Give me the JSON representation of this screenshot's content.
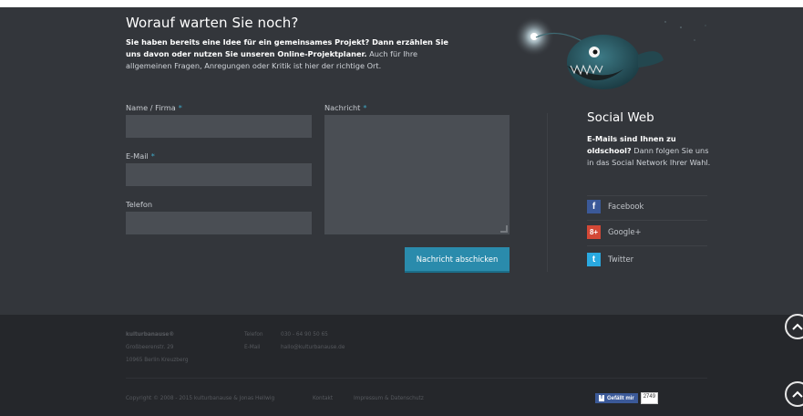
{
  "intro": {
    "title": "Worauf warten Sie noch?",
    "text_bold": "Sie haben bereits eine Idee für ein gemeinsames Projekt? Dann erzählen Sie uns davon oder nutzen Sie unseren Online-Projektplaner.",
    "text_rest": " Auch für Ihre allgemeinen Fragen, Anregungen oder Kritik ist hier der richtige Ort."
  },
  "form": {
    "name_label": "Name / Firma",
    "email_label": "E-Mail",
    "phone_label": "Telefon",
    "message_label": "Nachricht",
    "required_mark": "*",
    "submit_label": "Nachricht abschicken",
    "name_value": "",
    "email_value": "",
    "phone_value": "",
    "message_value": ""
  },
  "social": {
    "title": "Social Web",
    "text_bold": "E-Mails sind Ihnen zu oldschool?",
    "text_rest": " Dann folgen Sie uns in das Social Network Ihrer Wahl.",
    "items": [
      {
        "label": "Facebook",
        "icon": "facebook-icon",
        "glyph": "f",
        "color": "#3b5998"
      },
      {
        "label": "Google+",
        "icon": "google-plus-icon",
        "glyph": "8+",
        "color": "#d34836"
      },
      {
        "label": "Twitter",
        "icon": "twitter-icon",
        "glyph": "t",
        "color": "#2aa9e0"
      }
    ]
  },
  "footer": {
    "company": "kulturbanause®",
    "street": "Großbeerenstr. 29",
    "city": "10965 Berlin Kreuzberg",
    "phone_label": "Telefon",
    "phone_value": "030 - 64 90 50 65",
    "mail_label": "E-Mail",
    "mail_value": "hallo@kulturbanause.de",
    "copyright": "Copyright © 2008 - 2015 kulturbanause & Jonas Hellwig",
    "links": [
      "Kontakt",
      "Impressum & Datenschutz"
    ],
    "fb_like_label": "Gefällt mir",
    "fb_like_count": "2749"
  },
  "colors": {
    "main_bg": "#33363b",
    "footer_bg": "#25272b",
    "accent": "#2a8bac",
    "required": "#3fa7c4"
  }
}
